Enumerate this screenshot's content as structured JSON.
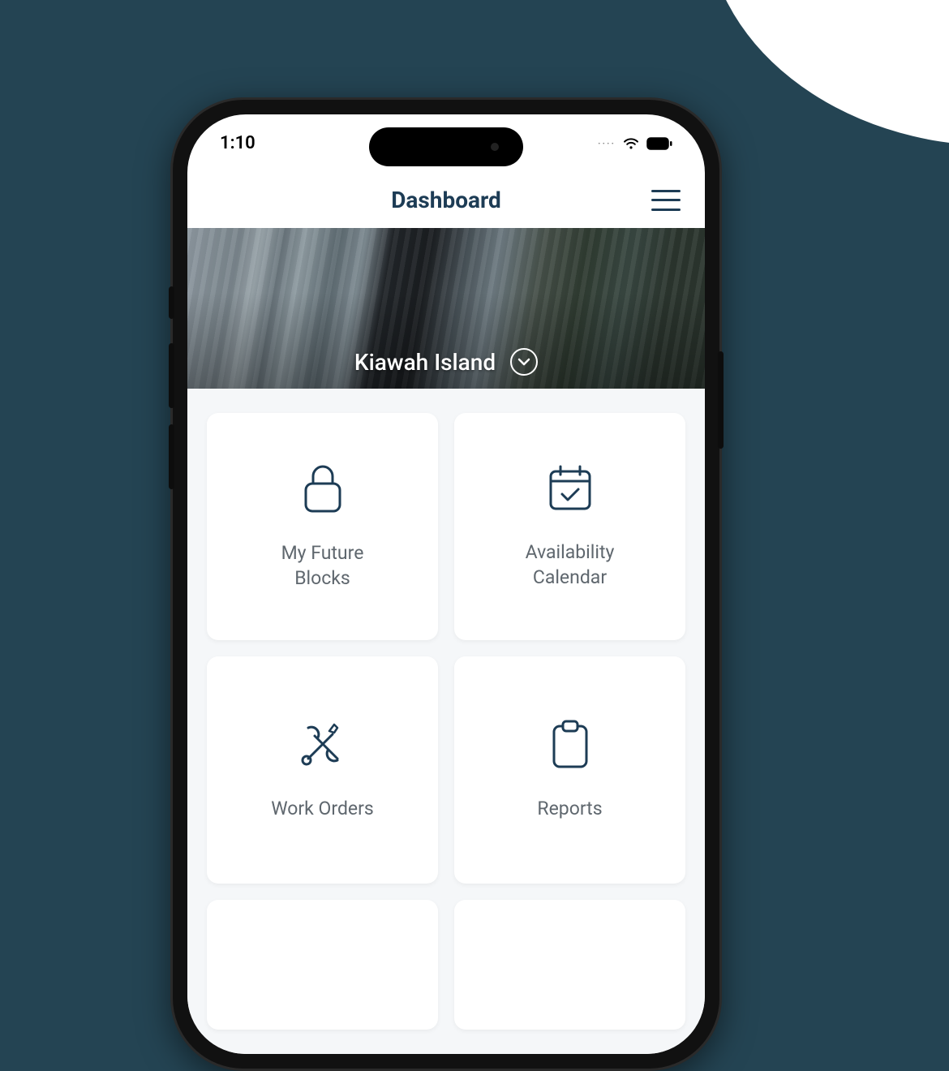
{
  "status": {
    "time": "1:10"
  },
  "nav": {
    "title": "Dashboard"
  },
  "hero": {
    "property_name": "Kiawah Island"
  },
  "tiles": {
    "future_blocks_label": "My Future\nBlocks",
    "availability_label": "Availability\nCalendar",
    "work_orders_label": "Work Orders",
    "reports_label": "Reports"
  },
  "colors": {
    "brand": "#1d3c55",
    "page_bg": "#244453",
    "content_bg": "#f5f7f9"
  }
}
